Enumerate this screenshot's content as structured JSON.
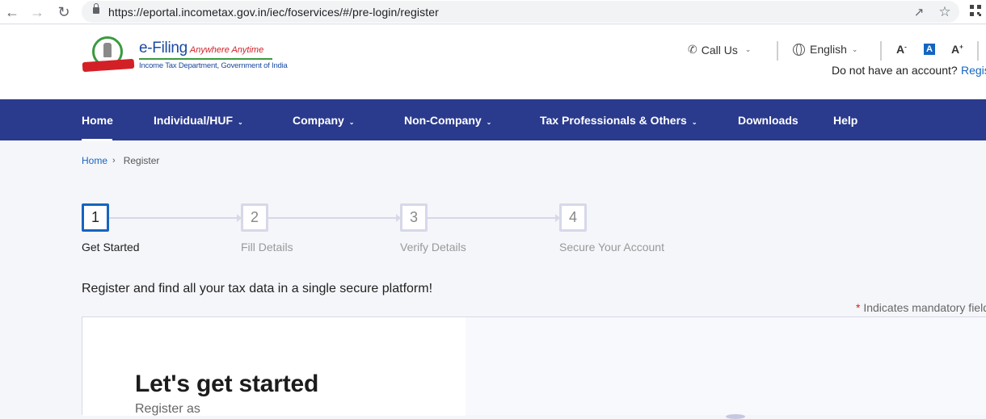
{
  "browser": {
    "url": "https://eportal.incometax.gov.in/iec/foservices/#/pre-login/register",
    "icons": [
      "back-arrow-icon",
      "forward-arrow-icon",
      "reload-icon",
      "lock-icon",
      "share-icon",
      "bookmark-star-icon",
      "qr-code-icon"
    ]
  },
  "header": {
    "brand_name": "e-Filing",
    "brand_tagline": "Anywhere Anytime",
    "brand_subtitle": "Income Tax Department, Government of India",
    "call_us": "Call Us",
    "language": "English",
    "font_decrease": "A",
    "font_normal": "A",
    "font_increase": "A",
    "account_prompt": "Do not have an account?",
    "register_link": "Register"
  },
  "nav": {
    "items": [
      {
        "label": "Home",
        "has_dropdown": false,
        "active": true
      },
      {
        "label": "Individual/HUF",
        "has_dropdown": true
      },
      {
        "label": "Company",
        "has_dropdown": true
      },
      {
        "label": "Non-Company",
        "has_dropdown": true
      },
      {
        "label": "Tax Professionals & Others",
        "has_dropdown": true
      },
      {
        "label": "Downloads",
        "has_dropdown": false
      },
      {
        "label": "Help",
        "has_dropdown": false
      }
    ]
  },
  "breadcrumb": {
    "home": "Home",
    "separator": "›",
    "current": "Register"
  },
  "stepper": {
    "steps": [
      {
        "number": "1",
        "label": "Get Started",
        "active": true
      },
      {
        "number": "2",
        "label": "Fill Details"
      },
      {
        "number": "3",
        "label": "Verify Details"
      },
      {
        "number": "4",
        "label": "Secure Your Account"
      }
    ]
  },
  "main": {
    "intro": "Register and find all your tax data in a single secure platform!",
    "mandatory_star": "*",
    "mandatory_note": "Indicates mandatory fields",
    "card_title": "Let's get started",
    "card_subtitle": "Register as"
  },
  "colors": {
    "nav_bg": "#2a3a8c",
    "link_blue": "#1565c0",
    "accent_red": "#d32027",
    "page_bg": "#f5f6fa"
  }
}
